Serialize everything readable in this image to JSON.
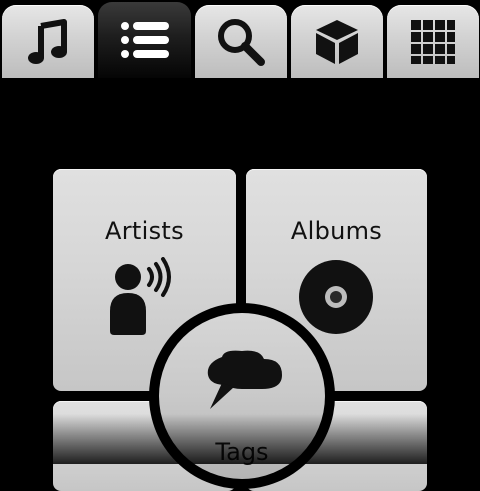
{
  "tabs": [
    {
      "icon": "music-note-icon",
      "active": false
    },
    {
      "icon": "list-icon",
      "active": true
    },
    {
      "icon": "search-icon",
      "active": false
    },
    {
      "icon": "cube-icon",
      "active": false
    },
    {
      "icon": "grid-icon",
      "active": false
    }
  ],
  "tiles": {
    "artists": {
      "label": "Artists",
      "icon": "artist-speaking-icon"
    },
    "albums": {
      "label": "Albums",
      "icon": "disc-icon"
    },
    "tags": {
      "label": "Tags",
      "icon": "speech-bubbles-icon"
    }
  },
  "colors": {
    "background": "#000000",
    "tile": "#d6d6d6",
    "active_tab": "#111111"
  }
}
